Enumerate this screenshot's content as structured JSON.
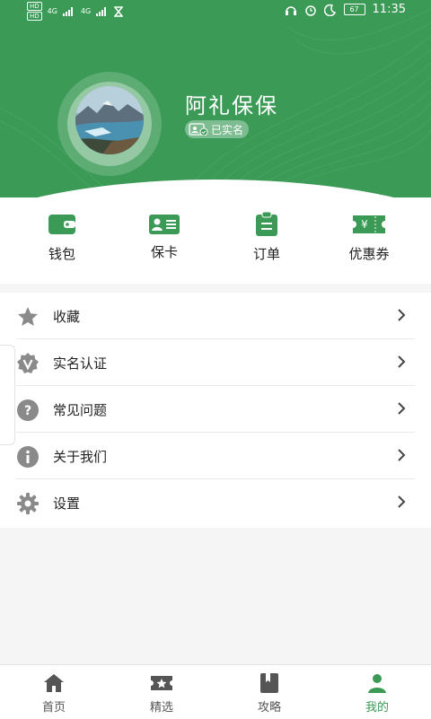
{
  "status_bar": {
    "left_tags": [
      "HD",
      "HD"
    ],
    "network": "4G",
    "battery": "67",
    "time": "11:35"
  },
  "profile": {
    "username": "阿礼保保",
    "verified_label": "已实名"
  },
  "quick_actions": [
    {
      "label": "钱包",
      "icon": "wallet-icon"
    },
    {
      "label": "保卡",
      "icon": "card-icon"
    },
    {
      "label": "订单",
      "icon": "order-icon"
    },
    {
      "label": "优惠券",
      "icon": "coupon-icon"
    }
  ],
  "menu": [
    {
      "label": "收藏",
      "icon": "star-icon"
    },
    {
      "label": "实名认证",
      "icon": "verify-icon"
    },
    {
      "label": "常见问题",
      "icon": "question-icon"
    },
    {
      "label": "关于我们",
      "icon": "info-icon"
    },
    {
      "label": "设置",
      "icon": "gear-icon"
    }
  ],
  "bottom_nav": {
    "items": [
      {
        "label": "首页",
        "icon": "home-icon"
      },
      {
        "label": "精选",
        "icon": "featured-icon"
      },
      {
        "label": "攻略",
        "icon": "guide-icon"
      },
      {
        "label": "我的",
        "icon": "profile-icon"
      }
    ],
    "active": "我的"
  },
  "colors": {
    "brand_green": "#3a9a56",
    "icon_gray": "#8a8a8a"
  }
}
